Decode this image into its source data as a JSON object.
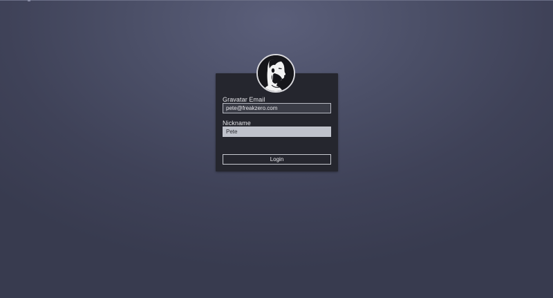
{
  "login": {
    "email_label": "Gravatar Email",
    "email_value": "pete@freakzero.com",
    "nickname_label": "Nickname",
    "nickname_value": "Pete",
    "login_button": "Login"
  },
  "avatar": {
    "icon": "bearded-man-profile-icon"
  },
  "colors": {
    "background": "#474a61",
    "panel": "#25262e",
    "nickname_field": "#bfc2cb",
    "text": "#e6e6ea"
  }
}
